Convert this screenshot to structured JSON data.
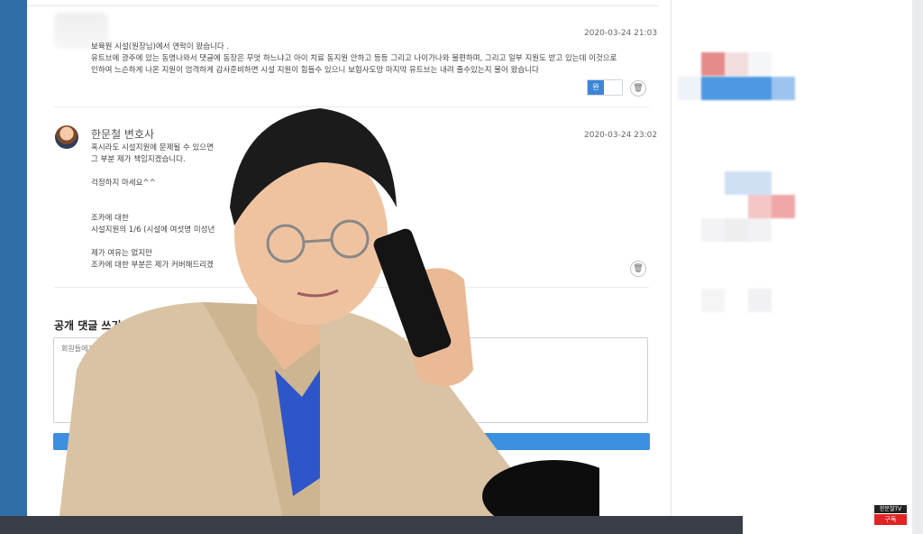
{
  "comments": [
    {
      "author": "",
      "time": "2020-03-24 21:03",
      "text": "보육원 시설(원장님)에서 연락이 왔습니다 .\n유트브에 광주에 있는 동명나와서 댓글에 동장은 무엇 하느냐고 아이 치료 동지원 안하고 등등 그리고 나이가나와 불편하며, 그리고 일부 지원도 받고 있는데 이것으로\n인하여 느슨하게 나온 지원이 엄격하게 감사준비하면 시설 지원이 힘들수 있으니 보험사도망 마지막 유트브는 내려 줄수있는지 물어 왔습니다",
      "toggle_label": "완"
    },
    {
      "author": "한문철 변호사",
      "time": "2020-03-24 23:02",
      "text": "혹시라도 시설지원에 문제될 수 있으면\n그 부분 제가 책임지겠습니다.\n\n걱정하지 마세요^^\n\n\n조카에 대한\n시설지원의 1/6 (시설에 여섯명 미성년\n\n제가 여유는 없지만\n조카에 대한 부분은 제가 커버해드리겠"
    }
  ],
  "write": {
    "title": "공개 댓글 쓰기",
    "placeholder": "회원들에게 공개 되는 댓글"
  },
  "icons": {
    "delete": "trash-icon",
    "avatar": "avatar-icon"
  },
  "badge": {
    "channel": "한문철TV",
    "subscribe": "구독"
  },
  "colors": {
    "accent": "#3d86d6",
    "left_strip": "#2f6ea6",
    "button": "#3d8fe0"
  }
}
